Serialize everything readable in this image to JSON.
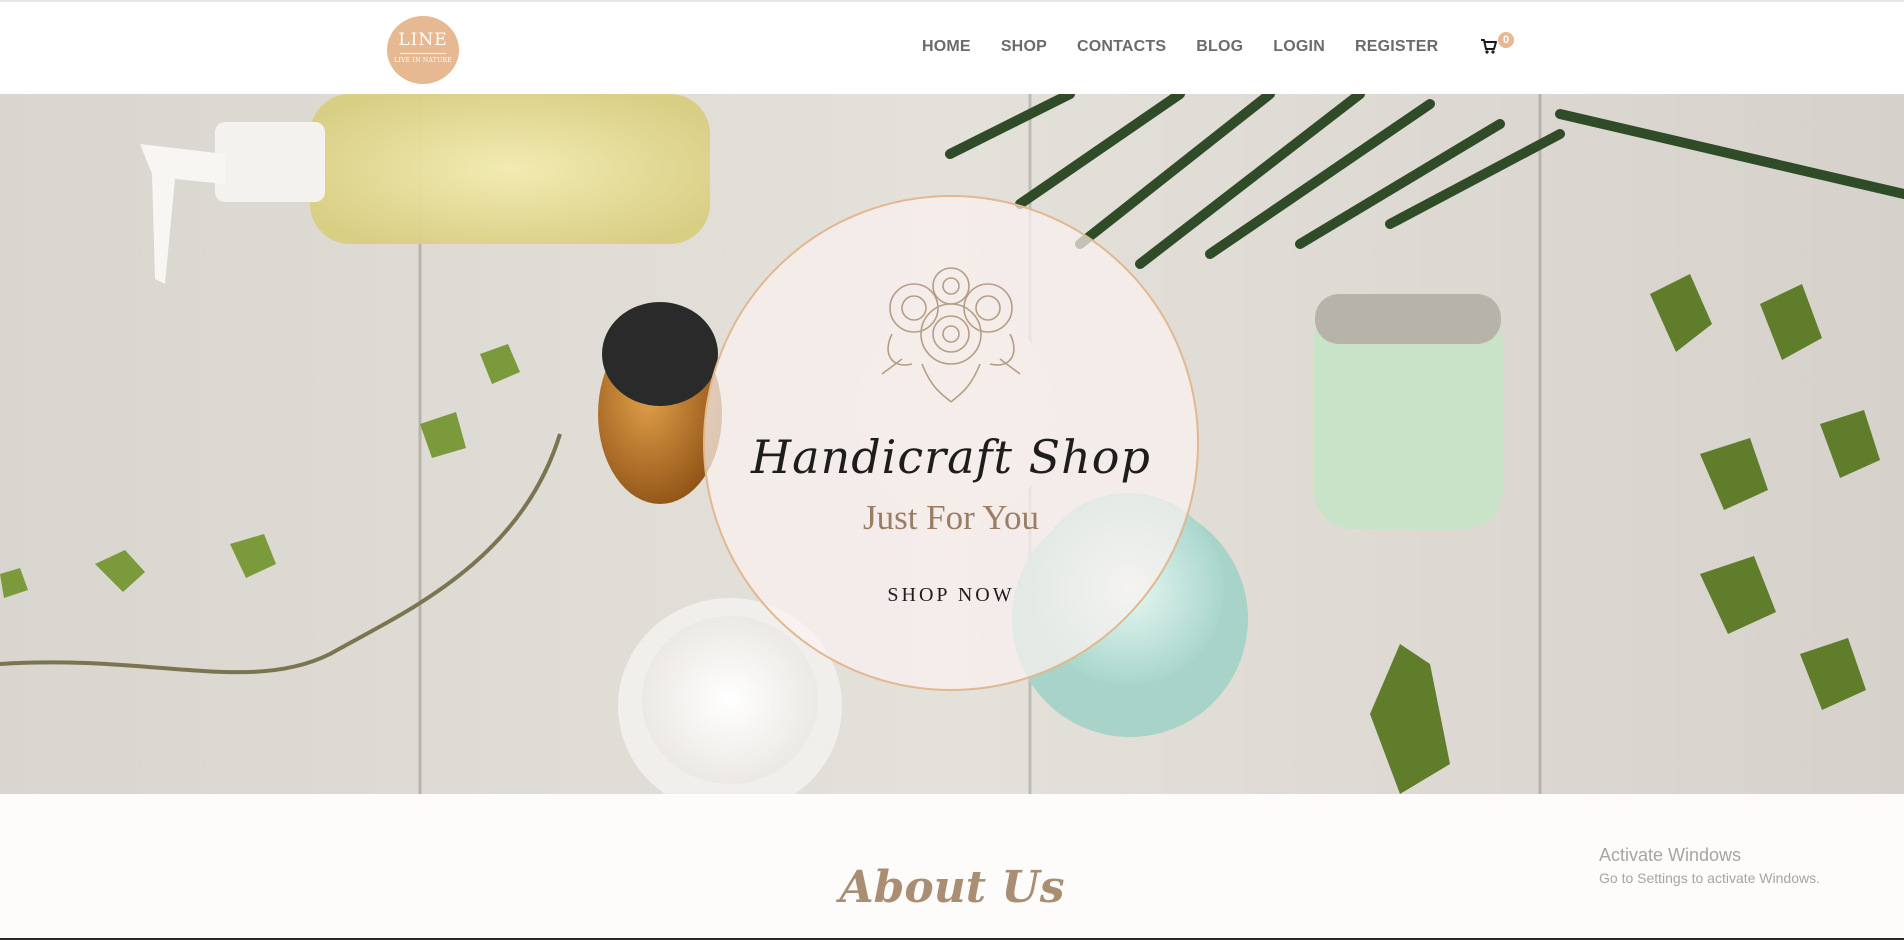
{
  "logo": {
    "main": "LINE",
    "sub": "LIVE IN NATURE"
  },
  "nav": {
    "items": [
      "HOME",
      "SHOP",
      "CONTACTS",
      "BLOG",
      "LOGIN",
      "REGISTER"
    ],
    "cart_icon": "shopping-cart-icon",
    "cart_count": "0"
  },
  "hero": {
    "title": "Handicraft Shop",
    "subtitle": "Just For You",
    "cta": "SHOP NOW",
    "emblem_icon": "rose-bouquet-icon"
  },
  "about": {
    "title": "About Us"
  },
  "watermark": {
    "line1": "Activate Windows",
    "line2": "Go to Settings to activate Windows."
  },
  "colors": {
    "accent": "#e6b993",
    "nav_text": "#6b6b6b",
    "subtitle": "#9a7e64",
    "about_title": "#a98e73",
    "circle_border": "#e1b88f"
  }
}
